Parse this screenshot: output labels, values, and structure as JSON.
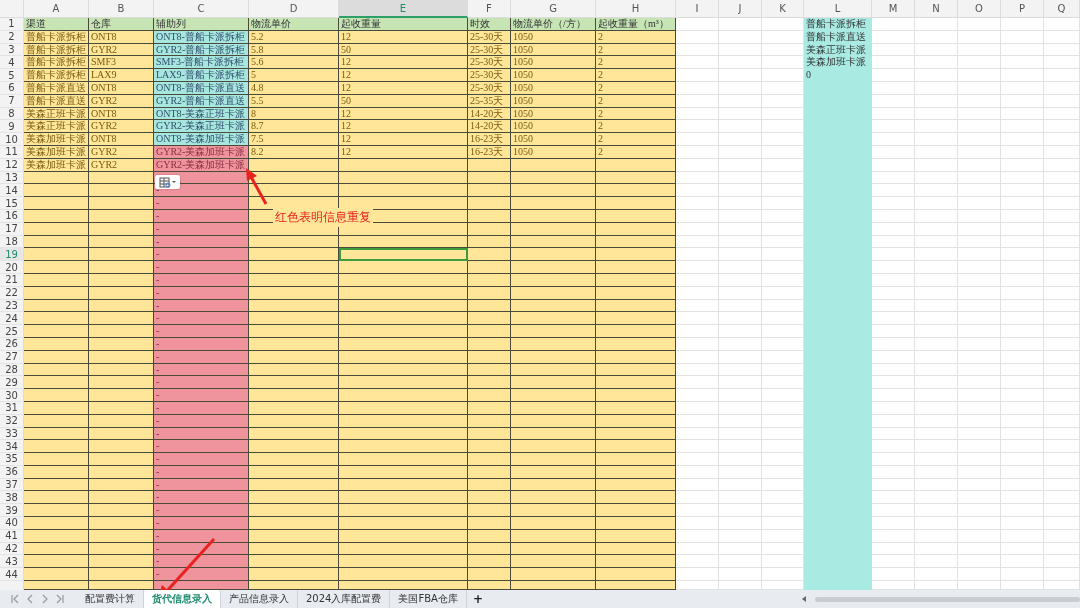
{
  "columns": [
    {
      "letter": "A",
      "kind": "table",
      "selected": false
    },
    {
      "letter": "B",
      "kind": "table",
      "selected": false
    },
    {
      "letter": "C",
      "kind": "helper",
      "selected": false
    },
    {
      "letter": "D",
      "kind": "table",
      "selected": false
    },
    {
      "letter": "E",
      "kind": "table",
      "selected": true
    },
    {
      "letter": "F",
      "kind": "table",
      "selected": false
    },
    {
      "letter": "G",
      "kind": "table",
      "selected": false
    },
    {
      "letter": "H",
      "kind": "table",
      "selected": false
    },
    {
      "letter": "I",
      "kind": "blank",
      "selected": false
    },
    {
      "letter": "J",
      "kind": "blank",
      "selected": false
    },
    {
      "letter": "K",
      "kind": "blank",
      "selected": false
    },
    {
      "letter": "L",
      "kind": "list",
      "selected": false
    },
    {
      "letter": "M",
      "kind": "blank",
      "selected": false
    },
    {
      "letter": "N",
      "kind": "blank",
      "selected": false
    },
    {
      "letter": "O",
      "kind": "blank",
      "selected": false
    },
    {
      "letter": "P",
      "kind": "blank",
      "selected": false
    },
    {
      "letter": "Q",
      "kind": "blank",
      "selected": false
    }
  ],
  "rows": [
    {
      "number": "1",
      "kind": "header",
      "selected": false,
      "cells": {
        "A": "渠道",
        "B": "仓库",
        "C": "辅助列",
        "D": "物流单价",
        "E": "起收重量",
        "F": "时效",
        "G": "物流单价（/方）",
        "H": "起收重量（m³）",
        "L": "普船卡派拆柜"
      }
    },
    {
      "number": "2",
      "kind": "data",
      "selected": false,
      "duplicate": false,
      "cells": {
        "A": "普船卡派拆柜",
        "B": "ONT8",
        "C": "ONT8-普船卡派拆柜",
        "D": "5.2",
        "E": "12",
        "F": "25-30天",
        "G": "1050",
        "H": "2",
        "L": "普船卡派直送"
      }
    },
    {
      "number": "3",
      "kind": "data",
      "selected": false,
      "duplicate": false,
      "cells": {
        "A": "普船卡派拆柜",
        "B": "GYR2",
        "C": "GYR2-普船卡派拆柜",
        "D": "5.8",
        "E": "50",
        "F": "25-30天",
        "G": "1050",
        "H": "2",
        "L": "美森正班卡派"
      }
    },
    {
      "number": "4",
      "kind": "data",
      "selected": false,
      "duplicate": false,
      "cells": {
        "A": "普船卡派拆柜",
        "B": "SMF3",
        "C": "SMF3-普船卡派拆柜",
        "D": "5.6",
        "E": "12",
        "F": "25-30天",
        "G": "1050",
        "H": "2",
        "L": "美森加班卡派"
      }
    },
    {
      "number": "5",
      "kind": "data",
      "selected": false,
      "duplicate": false,
      "cells": {
        "A": "普船卡派拆柜",
        "B": "LAX9",
        "C": "LAX9-普船卡派拆柜",
        "D": "5",
        "E": "12",
        "F": "25-30天",
        "G": "1050",
        "H": "2",
        "L": "0"
      }
    },
    {
      "number": "6",
      "kind": "data",
      "selected": false,
      "duplicate": false,
      "cells": {
        "A": "普船卡派直送",
        "B": "ONT8",
        "C": "ONT8-普船卡派直送",
        "D": "4.8",
        "E": "12",
        "F": "25-30天",
        "G": "1050",
        "H": "2"
      }
    },
    {
      "number": "7",
      "kind": "data",
      "selected": false,
      "duplicate": false,
      "cells": {
        "A": "普船卡派直送",
        "B": "GYR2",
        "C": "GYR2-普船卡派直送",
        "D": "5.5",
        "E": "50",
        "F": "25-35天",
        "G": "1050",
        "H": "2"
      }
    },
    {
      "number": "8",
      "kind": "data",
      "selected": false,
      "duplicate": false,
      "cells": {
        "A": "美森正班卡派",
        "B": "ONT8",
        "C": "ONT8-美森正班卡派",
        "D": "8",
        "E": "12",
        "F": "14-20天",
        "G": "1050",
        "H": "2"
      }
    },
    {
      "number": "9",
      "kind": "data",
      "selected": false,
      "duplicate": false,
      "cells": {
        "A": "美森正班卡派",
        "B": "GYR2",
        "C": "GYR2-美森正班卡派",
        "D": "8.7",
        "E": "12",
        "F": "14-20天",
        "G": "1050",
        "H": "2"
      }
    },
    {
      "number": "10",
      "kind": "data",
      "selected": false,
      "duplicate": false,
      "cells": {
        "A": "美森加班卡派",
        "B": "ONT8",
        "C": "ONT8-美森加班卡派",
        "D": "7.5",
        "E": "12",
        "F": "16-23天",
        "G": "1050",
        "H": "2"
      }
    },
    {
      "number": "11",
      "kind": "data",
      "selected": false,
      "duplicate": true,
      "cells": {
        "A": "美森加班卡派",
        "B": "GYR2",
        "C": "GYR2-美森加班卡派",
        "D": "8.2",
        "E": "12",
        "F": "16-23天",
        "G": "1050",
        "H": "2"
      }
    },
    {
      "number": "12",
      "kind": "data",
      "selected": false,
      "duplicate": true,
      "cells": {
        "A": "美森加班卡派",
        "B": "GYR2",
        "C": "GYR2-美森加班卡派"
      }
    },
    {
      "number": "13",
      "kind": "data",
      "selected": false,
      "duplicate": true,
      "cells": {}
    },
    {
      "number": "14",
      "kind": "data",
      "selected": false,
      "duplicate": true,
      "cells": {
        "C": "-"
      }
    },
    {
      "number": "15",
      "kind": "data",
      "selected": false,
      "duplicate": true,
      "cells": {
        "C": "-"
      }
    },
    {
      "number": "16",
      "kind": "data",
      "selected": false,
      "duplicate": true,
      "cells": {
        "C": "-"
      }
    },
    {
      "number": "17",
      "kind": "data",
      "selected": false,
      "duplicate": true,
      "cells": {
        "C": "-"
      }
    },
    {
      "number": "18",
      "kind": "data",
      "selected": false,
      "duplicate": true,
      "cells": {
        "C": "-"
      }
    },
    {
      "number": "19",
      "kind": "data",
      "selected": true,
      "duplicate": true,
      "cells": {
        "C": "-"
      }
    },
    {
      "number": "20",
      "kind": "data",
      "selected": false,
      "duplicate": true,
      "cells": {
        "C": "-"
      }
    },
    {
      "number": "21",
      "kind": "data",
      "selected": false,
      "duplicate": true,
      "cells": {
        "C": "-"
      }
    },
    {
      "number": "22",
      "kind": "data",
      "selected": false,
      "duplicate": true,
      "cells": {
        "C": "-"
      }
    },
    {
      "number": "23",
      "kind": "data",
      "selected": false,
      "duplicate": true,
      "cells": {
        "C": "-"
      }
    },
    {
      "number": "24",
      "kind": "data",
      "selected": false,
      "duplicate": true,
      "cells": {
        "C": "-"
      }
    },
    {
      "number": "25",
      "kind": "data",
      "selected": false,
      "duplicate": true,
      "cells": {
        "C": "-"
      }
    },
    {
      "number": "26",
      "kind": "data",
      "selected": false,
      "duplicate": true,
      "cells": {
        "C": "-"
      }
    },
    {
      "number": "27",
      "kind": "data",
      "selected": false,
      "duplicate": true,
      "cells": {
        "C": "-"
      }
    },
    {
      "number": "28",
      "kind": "data",
      "selected": false,
      "duplicate": true,
      "cells": {
        "C": "-"
      }
    },
    {
      "number": "29",
      "kind": "data",
      "selected": false,
      "duplicate": true,
      "cells": {
        "C": "-"
      }
    },
    {
      "number": "30",
      "kind": "data",
      "selected": false,
      "duplicate": true,
      "cells": {
        "C": "-"
      }
    },
    {
      "number": "31",
      "kind": "data",
      "selected": false,
      "duplicate": true,
      "cells": {
        "C": "-"
      }
    },
    {
      "number": "32",
      "kind": "data",
      "selected": false,
      "duplicate": true,
      "cells": {
        "C": "-"
      }
    },
    {
      "number": "33",
      "kind": "data",
      "selected": false,
      "duplicate": true,
      "cells": {
        "C": "-"
      }
    },
    {
      "number": "34",
      "kind": "data",
      "selected": false,
      "duplicate": true,
      "cells": {
        "C": "-"
      }
    },
    {
      "number": "35",
      "kind": "data",
      "selected": false,
      "duplicate": true,
      "cells": {
        "C": "-"
      }
    },
    {
      "number": "36",
      "kind": "data",
      "selected": false,
      "duplicate": true,
      "cells": {
        "C": "-"
      }
    },
    {
      "number": "37",
      "kind": "data",
      "selected": false,
      "duplicate": true,
      "cells": {
        "C": "-"
      }
    },
    {
      "number": "38",
      "kind": "data",
      "selected": false,
      "duplicate": true,
      "cells": {
        "C": "-"
      }
    },
    {
      "number": "39",
      "kind": "data",
      "selected": false,
      "duplicate": true,
      "cells": {
        "C": "-"
      }
    },
    {
      "number": "40",
      "kind": "data",
      "selected": false,
      "duplicate": true,
      "cells": {
        "C": "-"
      }
    },
    {
      "number": "41",
      "kind": "data",
      "selected": false,
      "duplicate": true,
      "cells": {
        "C": "-"
      }
    },
    {
      "number": "42",
      "kind": "data",
      "selected": false,
      "duplicate": true,
      "cells": {
        "C": "-"
      }
    },
    {
      "number": "43",
      "kind": "data",
      "selected": false,
      "duplicate": true,
      "cells": {
        "C": "-"
      }
    },
    {
      "number": "44",
      "kind": "data",
      "selected": false,
      "duplicate": true,
      "cells": {
        "C": "-"
      }
    }
  ],
  "annotation": {
    "text": "红色表明信息重复"
  },
  "sheet_tabs": [
    {
      "label": "配置费计算",
      "selected": false
    },
    {
      "label": "货代信息录入",
      "selected": true
    },
    {
      "label": "产品信息录入",
      "selected": false
    },
    {
      "label": "2024入库配置费",
      "selected": false
    },
    {
      "label": "美国FBA仓库",
      "selected": false
    }
  ],
  "add_sheet": "+"
}
